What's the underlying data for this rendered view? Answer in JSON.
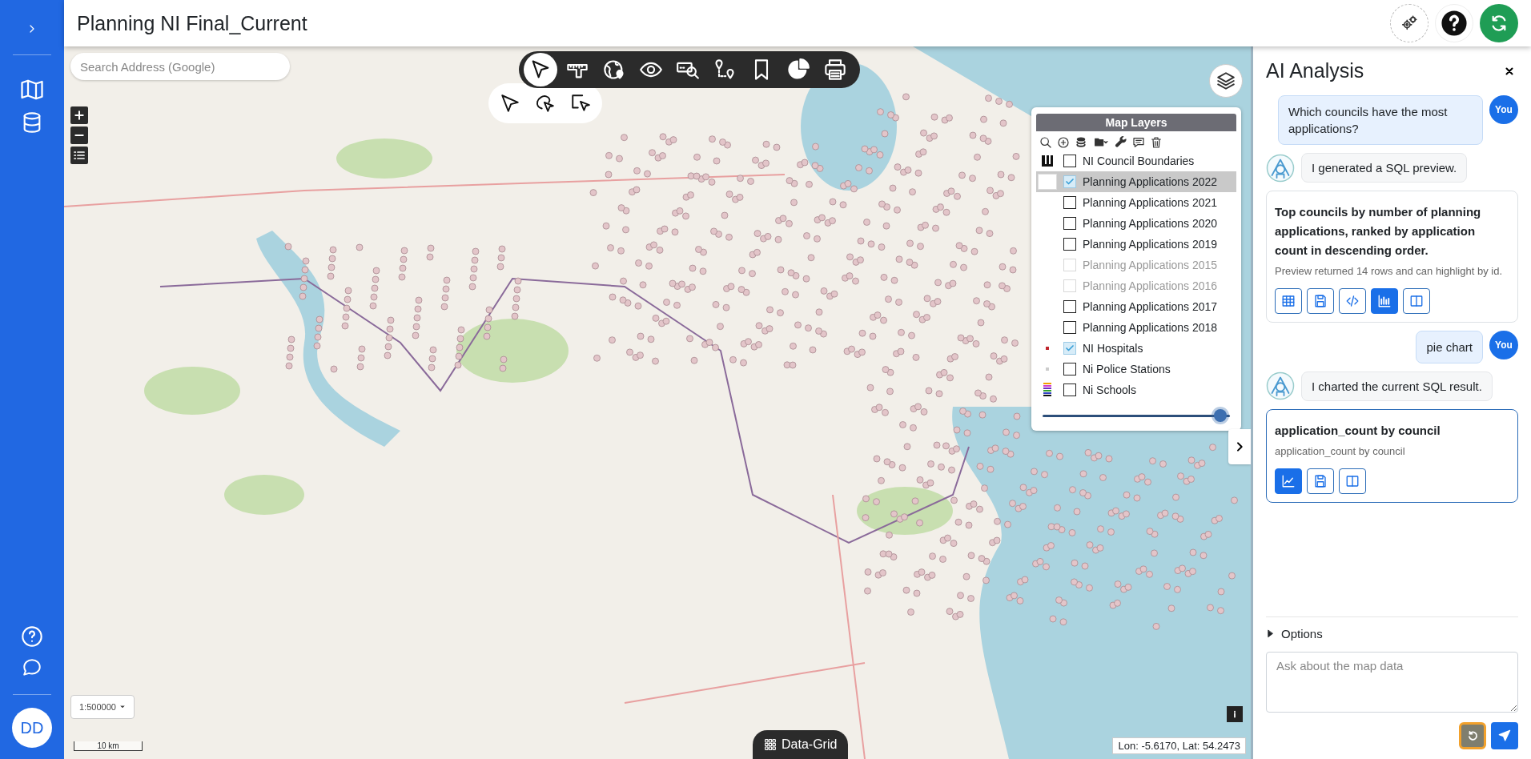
{
  "header": {
    "title": "Planning NI Final_Current"
  },
  "sidebar": {
    "avatar": "DD"
  },
  "map": {
    "search": {
      "placeholder": "Search Address (Google)"
    },
    "scale_select": {
      "value": "1:500000"
    },
    "scale_bar": "10 km",
    "data_grid_button": "Data-Grid",
    "coordinates": "Lon: -5.6170, Lat: 54.2473"
  },
  "map_toolbar": {
    "tools": [
      {
        "kind": "select",
        "selected": true
      },
      {
        "kind": "measure",
        "selected": false
      },
      {
        "kind": "globe",
        "selected": false
      },
      {
        "kind": "eye",
        "selected": false
      },
      {
        "kind": "find",
        "selected": false
      },
      {
        "kind": "route",
        "selected": false
      },
      {
        "kind": "bookmark",
        "selected": false
      },
      {
        "kind": "pie",
        "selected": false
      },
      {
        "kind": "print",
        "selected": false
      }
    ],
    "sub_tools": [
      {
        "kind": "arrow"
      },
      {
        "kind": "lasso"
      },
      {
        "kind": "rect"
      }
    ]
  },
  "layers_panel": {
    "title": "Map Layers",
    "layers": [
      {
        "name": "NI Council Boundaries",
        "kind": "bars",
        "checked": false,
        "disabled": false,
        "selected": false
      },
      {
        "name": "Planning Applications 2022",
        "kind": "blank",
        "checked": true,
        "disabled": false,
        "selected": true
      },
      {
        "name": "Planning Applications 2021",
        "kind": "none",
        "checked": false,
        "disabled": false,
        "selected": false
      },
      {
        "name": "Planning Applications 2020",
        "kind": "none",
        "checked": false,
        "disabled": false,
        "selected": false
      },
      {
        "name": "Planning Applications 2019",
        "kind": "none",
        "checked": false,
        "disabled": false,
        "selected": false
      },
      {
        "name": "Planning Applications 2015",
        "kind": "none",
        "checked": false,
        "disabled": true,
        "selected": false
      },
      {
        "name": "Planning Applications 2016",
        "kind": "none",
        "checked": false,
        "disabled": true,
        "selected": false
      },
      {
        "name": "Planning Applications 2017",
        "kind": "none",
        "checked": false,
        "disabled": false,
        "selected": false
      },
      {
        "name": "Planning Applications 2018",
        "kind": "none",
        "checked": false,
        "disabled": false,
        "selected": false
      },
      {
        "name": "NI Hospitals",
        "kind": "dot",
        "checked": true,
        "disabled": false,
        "selected": false
      },
      {
        "name": "Ni Police Stations",
        "kind": "faint",
        "checked": false,
        "disabled": false,
        "selected": false
      },
      {
        "name": "Ni Schools",
        "kind": "stripes",
        "checked": false,
        "disabled": false,
        "selected": false
      }
    ],
    "opacity": {
      "level": 0.95
    }
  },
  "ai_panel": {
    "title": "AI Analysis",
    "messages": [
      {
        "kind": "user",
        "text": "Which councils have the most applications?",
        "avatar": "You"
      },
      {
        "kind": "bot",
        "text": "I generated a SQL preview."
      },
      {
        "kind": "card",
        "focused": false,
        "title": "Top councils by number of planning applications, ranked by application count in descending order.",
        "subtitle": "Preview returned 14 rows and can highlight by id.",
        "actions": [
          {
            "kind": "table",
            "selected": false
          },
          {
            "kind": "save",
            "selected": false
          },
          {
            "kind": "code",
            "selected": false
          },
          {
            "kind": "bar",
            "selected": true
          },
          {
            "kind": "columns",
            "selected": false
          }
        ]
      },
      {
        "kind": "user",
        "text": "pie chart",
        "avatar": "You"
      },
      {
        "kind": "bot",
        "text": "I charted the current SQL result."
      },
      {
        "kind": "card",
        "focused": true,
        "title": "application_count by council",
        "subtitle": "application_count by council",
        "actions": [
          {
            "kind": "line",
            "selected": true
          },
          {
            "kind": "save",
            "selected": false
          },
          {
            "kind": "columns",
            "selected": false
          }
        ]
      }
    ],
    "options": {
      "label": "Options",
      "expanded": false
    },
    "input": {
      "placeholder": "Ask about the map data"
    }
  }
}
